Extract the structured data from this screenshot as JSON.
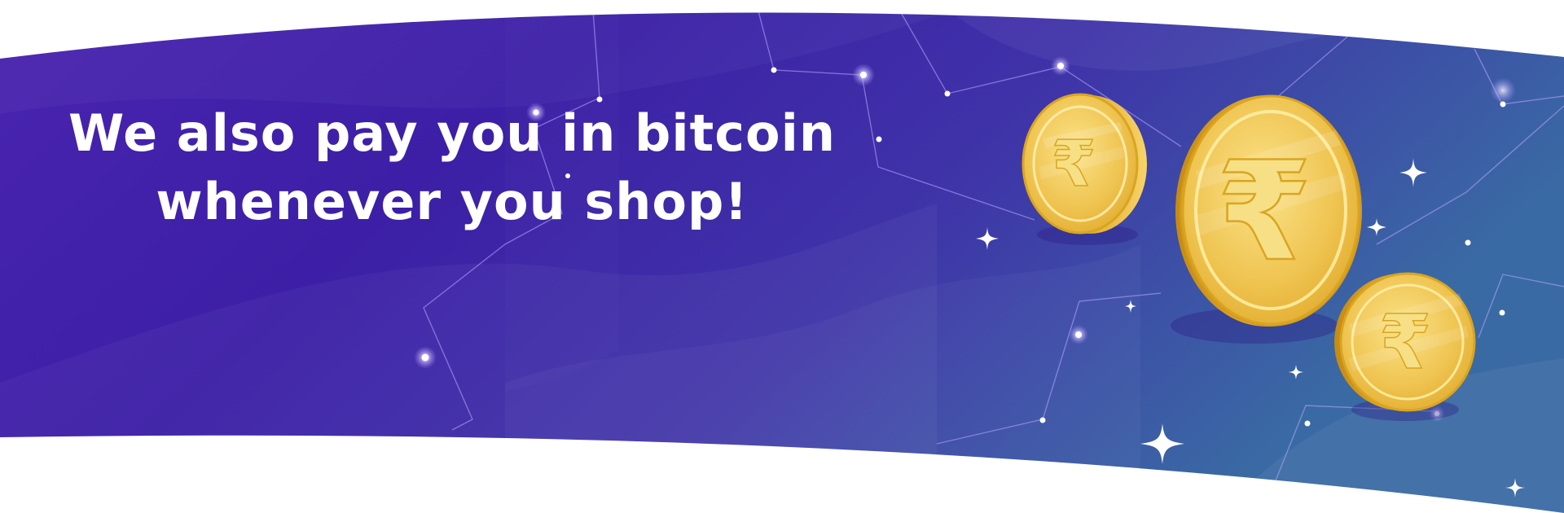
{
  "banner": {
    "headline_line1": "We also pay you in bitcoin",
    "headline_line2": "whenever you shop!"
  },
  "coins": {
    "symbol": "₹",
    "icon": "rupee-coin-icon",
    "count": 3
  },
  "colors": {
    "background_start": "#3b1fa8",
    "background_end": "#3a6fa6",
    "coin_gold": "#f2c94c",
    "coin_rim": "#d9a520",
    "text": "#ffffff"
  }
}
